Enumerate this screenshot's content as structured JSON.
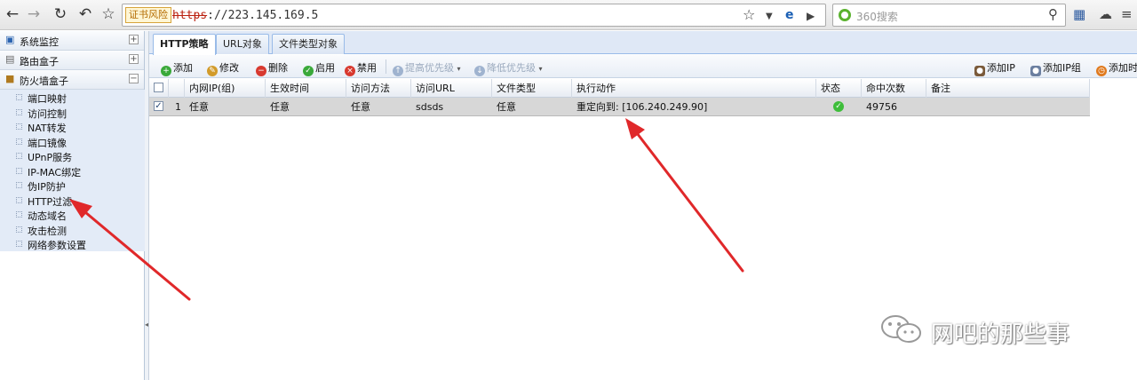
{
  "browser": {
    "cert_warning": "证书风险",
    "url_scheme": "https",
    "url_rest": "://223.145.169.5",
    "search_placeholder": "360搜索"
  },
  "sidebar": {
    "groups": [
      {
        "label": "系统监控",
        "toggle": "+"
      },
      {
        "label": "路由盒子",
        "toggle": "+"
      },
      {
        "label": "防火墙盒子",
        "toggle": "−"
      }
    ],
    "items": [
      {
        "label": "端口映射"
      },
      {
        "label": "访问控制"
      },
      {
        "label": "NAT转发"
      },
      {
        "label": "端口镜像"
      },
      {
        "label": "UPnP服务"
      },
      {
        "label": "IP-MAC绑定"
      },
      {
        "label": "伪IP防护"
      },
      {
        "label": "HTTP过滤"
      },
      {
        "label": "动态域名"
      },
      {
        "label": "攻击检测"
      },
      {
        "label": "网络参数设置"
      }
    ]
  },
  "tabs": [
    {
      "label": "HTTP策略",
      "active": true
    },
    {
      "label": "URL对象"
    },
    {
      "label": "文件类型对象"
    }
  ],
  "toolbar": {
    "add": "添加",
    "edit": "修改",
    "delete": "删除",
    "enable": "启用",
    "disable": "禁用",
    "raise_priority": "提高优先级",
    "lower_priority": "降低优先级",
    "add_ip": "添加IP",
    "add_ip_group": "添加IP组",
    "add_time": "添加时"
  },
  "table": {
    "columns": [
      "内网IP(组)",
      "生效时间",
      "访问方法",
      "访问URL",
      "文件类型",
      "执行动作",
      "状态",
      "命中次数",
      "备注"
    ],
    "rows": [
      {
        "checked": true,
        "index": "1",
        "ip_group": "任意",
        "time": "任意",
        "method": "任意",
        "url": "sdsds",
        "file_type": "任意",
        "action": "重定向到: [106.240.249.90]",
        "status": "enabled",
        "hits": "49756",
        "note": ""
      }
    ]
  },
  "watermark": {
    "text": "网吧的那些事"
  },
  "colors": {
    "annotation_arrow": "#e0282a",
    "selected_row": "#d7d7d7",
    "sidebar_sub_bg": "#e3ebf7",
    "tab_strip": "#dfe8f6"
  }
}
